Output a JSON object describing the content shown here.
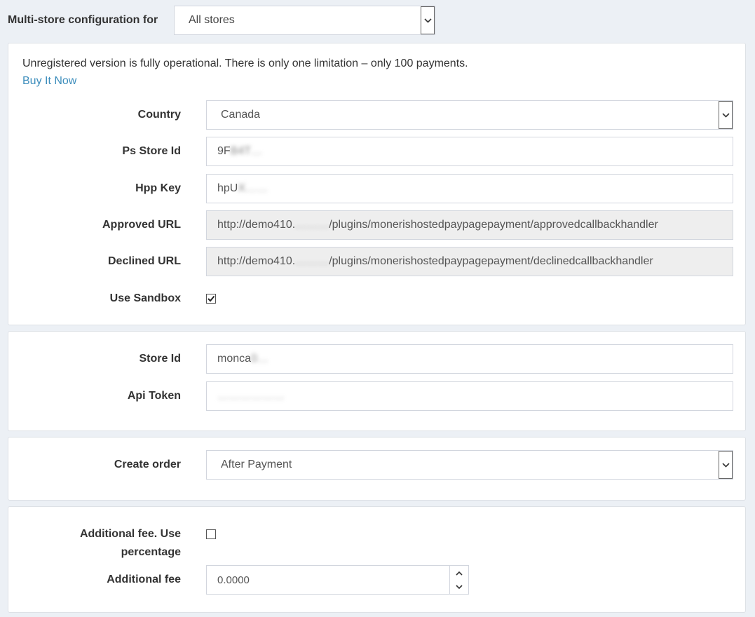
{
  "store_selector": {
    "label": "Multi-store configuration for",
    "value": "All stores"
  },
  "notice": {
    "text": "Unregistered version is fully operational. There is only one limitation – only 100 payments.",
    "link": "Buy It Now"
  },
  "settings": {
    "country_label": "Country",
    "country_value": "Canada",
    "ps_store_id_label": "Ps Store Id",
    "ps_store_id_visible": "9F",
    "ps_store_id_blurred": "B4T…",
    "hpp_key_label": "Hpp Key",
    "hpp_key_visible": "hpU",
    "hpp_key_blurred": "X……",
    "approved_url_label": "Approved URL",
    "approved_url_prefix": "http://demo410.",
    "approved_url_blurred": "………",
    "approved_url_suffix": "/plugins/monerishostedpaypagepayment/approvedcallbackhandler",
    "declined_url_label": "Declined URL",
    "declined_url_prefix": "http://demo410.",
    "declined_url_blurred": "………",
    "declined_url_suffix": "/plugins/monerishostedpaypagepayment/declinedcallbackhandler",
    "use_sandbox_label": "Use Sandbox",
    "use_sandbox_checked": true
  },
  "api": {
    "store_id_label": "Store Id",
    "store_id_visible": "monca",
    "store_id_blurred": "0…",
    "api_token_label": "Api Token",
    "api_token_blurred": "………………"
  },
  "order": {
    "create_order_label": "Create order",
    "create_order_value": "After Payment"
  },
  "fee": {
    "use_percentage_label": "Additional fee. Use percentage",
    "use_percentage_checked": false,
    "additional_fee_label": "Additional fee",
    "additional_fee_value": "0.0000"
  },
  "icons": {
    "dropdown": "chevron-down-icon",
    "check": "checkmark-icon",
    "spinner_up": "chevron-up-icon",
    "spinner_down": "chevron-down-icon"
  },
  "colors": {
    "link": "#3c8dbc",
    "page_background": "#ecf0f5",
    "readonly_background": "#eeeeee"
  }
}
